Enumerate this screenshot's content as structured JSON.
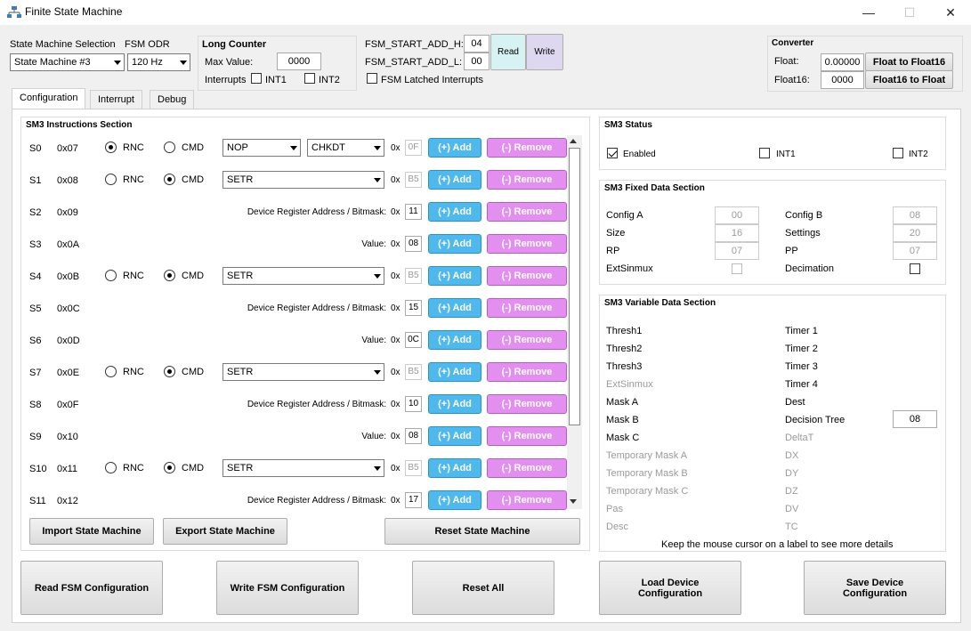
{
  "window": {
    "title": "Finite State Machine"
  },
  "top": {
    "sm_selection_label": "State Machine Selection",
    "sm_selection_value": "State Machine #3",
    "odr_label": "FSM ODR",
    "odr_value": "120 Hz"
  },
  "long_counter": {
    "title": "Long Counter",
    "max_label": "Max Value:",
    "max_value": "0000",
    "interrupts_label": "Interrupts",
    "int1": "INT1",
    "int2": "INT2"
  },
  "fsm_addr": {
    "h_label": "FSM_START_ADD_H:",
    "h_value": "04",
    "l_label": "FSM_START_ADD_L:",
    "l_value": "00",
    "read": "Read",
    "write": "Write",
    "latched": "FSM Latched Interrupts"
  },
  "converter": {
    "title": "Converter",
    "float_label": "Float:",
    "float_value": "0.00000",
    "f2f16": "Float to Float16",
    "float16_label": "Float16:",
    "float16_value": "0000",
    "f162f": "Float16 to Float"
  },
  "tabs": [
    "Configuration",
    "Interrupt",
    "Debug"
  ],
  "instructions": {
    "title": "SM3 Instructions Section",
    "add": "(+) Add",
    "remove": "(-) Remove",
    "hex_prefix": "0x",
    "rows": [
      {
        "name": "S0",
        "addr": "0x07",
        "kind": "radio",
        "rnc": "RNC",
        "cmd": "CMD",
        "selected": "RNC",
        "dd1": "NOP",
        "dd2": "CHKDT",
        "value": "0F",
        "value_disabled": true
      },
      {
        "name": "S1",
        "addr": "0x08",
        "kind": "radio",
        "rnc": "RNC",
        "cmd": "CMD",
        "selected": "CMD",
        "dd1": "SETR",
        "value": "B5",
        "value_disabled": true
      },
      {
        "name": "S2",
        "addr": "0x09",
        "kind": "text",
        "text": "Device Register Address / Bitmask:",
        "value": "11"
      },
      {
        "name": "S3",
        "addr": "0x0A",
        "kind": "text",
        "text": "Value:",
        "value": "08"
      },
      {
        "name": "S4",
        "addr": "0x0B",
        "kind": "radio",
        "rnc": "RNC",
        "cmd": "CMD",
        "selected": "CMD",
        "dd1": "SETR",
        "value": "B5",
        "value_disabled": true
      },
      {
        "name": "S5",
        "addr": "0x0C",
        "kind": "text",
        "text": "Device Register Address / Bitmask:",
        "value": "15"
      },
      {
        "name": "S6",
        "addr": "0x0D",
        "kind": "text",
        "text": "Value:",
        "value": "0C"
      },
      {
        "name": "S7",
        "addr": "0x0E",
        "kind": "radio",
        "rnc": "RNC",
        "cmd": "CMD",
        "selected": "CMD",
        "dd1": "SETR",
        "value": "B5",
        "value_disabled": true
      },
      {
        "name": "S8",
        "addr": "0x0F",
        "kind": "text",
        "text": "Device Register Address / Bitmask:",
        "value": "10"
      },
      {
        "name": "S9",
        "addr": "0x10",
        "kind": "text",
        "text": "Value:",
        "value": "08"
      },
      {
        "name": "S10",
        "addr": "0x11",
        "kind": "radio",
        "rnc": "RNC",
        "cmd": "CMD",
        "selected": "CMD",
        "dd1": "SETR",
        "value": "B5",
        "value_disabled": true
      },
      {
        "name": "S11",
        "addr": "0x12",
        "kind": "text",
        "text": "Device Register Address / Bitmask:",
        "value": "17"
      }
    ],
    "import": "Import State Machine",
    "export": "Export State Machine",
    "reset": "Reset State Machine"
  },
  "status": {
    "title": "SM3 Status",
    "enabled": "Enabled",
    "int1": "INT1",
    "int2": "INT2"
  },
  "fixed": {
    "title": "SM3 Fixed Data Section",
    "config_a": "Config A",
    "config_a_val": "00",
    "config_b": "Config B",
    "config_b_val": "08",
    "size": "Size",
    "size_val": "16",
    "settings": "Settings",
    "settings_val": "20",
    "rp": "RP",
    "rp_val": "07",
    "pp": "PP",
    "pp_val": "07",
    "extsinmux": "ExtSinmux",
    "decimation": "Decimation"
  },
  "variable": {
    "title": "SM3 Variable Data Section",
    "left": [
      {
        "label": "Thresh1",
        "disabled": false
      },
      {
        "label": "Thresh2",
        "disabled": false
      },
      {
        "label": "Thresh3",
        "disabled": false
      },
      {
        "label": "ExtSinmux",
        "disabled": true
      },
      {
        "label": "Mask A",
        "disabled": false
      },
      {
        "label": "Mask B",
        "disabled": false
      },
      {
        "label": "Mask C",
        "disabled": false
      },
      {
        "label": "Temporary Mask A",
        "disabled": true
      },
      {
        "label": "Temporary Mask B",
        "disabled": true
      },
      {
        "label": "Temporary Mask C",
        "disabled": true
      },
      {
        "label": "Pas",
        "disabled": true
      },
      {
        "label": "Desc",
        "disabled": true
      }
    ],
    "right": [
      {
        "label": "Timer 1",
        "disabled": false
      },
      {
        "label": "Timer 2",
        "disabled": false
      },
      {
        "label": "Timer 3",
        "disabled": false
      },
      {
        "label": "Timer 4",
        "disabled": false
      },
      {
        "label": "Dest",
        "disabled": false
      },
      {
        "label": "Decision Tree",
        "disabled": false
      },
      {
        "label": "DeltaT",
        "disabled": true
      },
      {
        "label": "DX",
        "disabled": true
      },
      {
        "label": "DY",
        "disabled": true
      },
      {
        "label": "DZ",
        "disabled": true
      },
      {
        "label": "DV",
        "disabled": true
      },
      {
        "label": "TC",
        "disabled": true
      }
    ],
    "decision_tree_value": "08",
    "hint": "Keep the mouse cursor on a label to see more details"
  },
  "bottom": {
    "read": "Read FSM Configuration",
    "write": "Write FSM Configuration",
    "reset": "Reset All",
    "load": "Load Device Configuration",
    "save": "Save Device Configuration"
  }
}
